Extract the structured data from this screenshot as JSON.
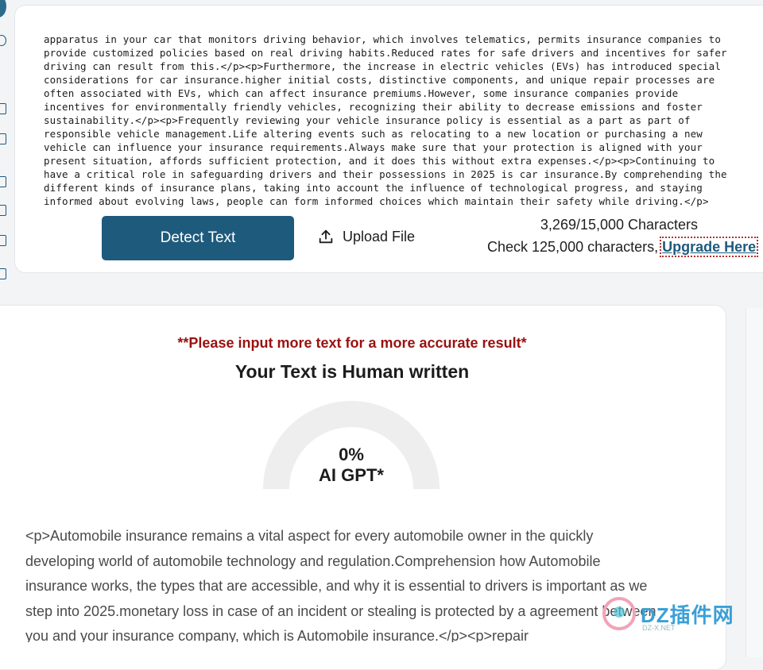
{
  "editor": {
    "lines": [
      "apparatus in your car that monitors driving behavior, which involves telematics, permits insurance companies to",
      "provide customized policies based on real driving habits.Reduced rates for safe drivers and incentives for safer",
      "driving can result from this.</p><p>Furthermore, the increase in electric vehicles (EVs) has introduced special",
      "considerations for car insurance.higher initial costs, distinctive components, and unique repair processes are",
      "often associated with EVs, which can affect insurance premiums.However, some insurance companies provide",
      "incentives for environmentally friendly vehicles, recognizing their ability to decrease emissions and foster",
      "sustainability.</p><p>Frequently reviewing your vehicle insurance policy is essential as a part as part of",
      "responsible vehicle management.Life altering events such as relocating to a new location or purchasing a new",
      "vehicle can influence your insurance requirements.Always make sure that your protection is aligned with your",
      "present situation, affords sufficient protection, and it does this without extra expenses.</p><p>Continuing to",
      "have a critical role in safeguarding drivers and their possessions in 2025 is car insurance.By comprehending the",
      "different kinds of insurance plans, taking into account the influence of technological progress, and staying",
      "informed about evolving laws, people can form informed choices which maintain their safety while driving.</p>"
    ]
  },
  "actions": {
    "detect_label": "Detect Text",
    "upload_label": "Upload File"
  },
  "usage": {
    "char_count": "3,269/15,000 Characters",
    "check_prefix": "Check 125,000 characters,",
    "upgrade_label": "Upgrade Here"
  },
  "result": {
    "warning": "**Please input more text for a more accurate result*",
    "verdict": "Your Text is Human written",
    "gauge_value": "0%",
    "gauge_label": "AI GPT*",
    "ai_fraction": 0,
    "output": "<p>Automobile insurance remains a vital aspect for every automobile owner in the quickly developing world of automobile technology and regulation.Comprehension how Automobile insurance works, the types that are accessible, and why it is essential to drivers is important as we step into 2025.monetary loss in case of an incident or stealing is protected by a agreement between you and your insurance company, which is Automobile insurance.</p><p>repair"
  },
  "watermark": {
    "text": "DZ插件网",
    "sub": "DZ-X.NET"
  },
  "colors": {
    "accent": "#1e5a7c",
    "warning": "#9a1111",
    "gauge_track": "#eeeeee"
  }
}
